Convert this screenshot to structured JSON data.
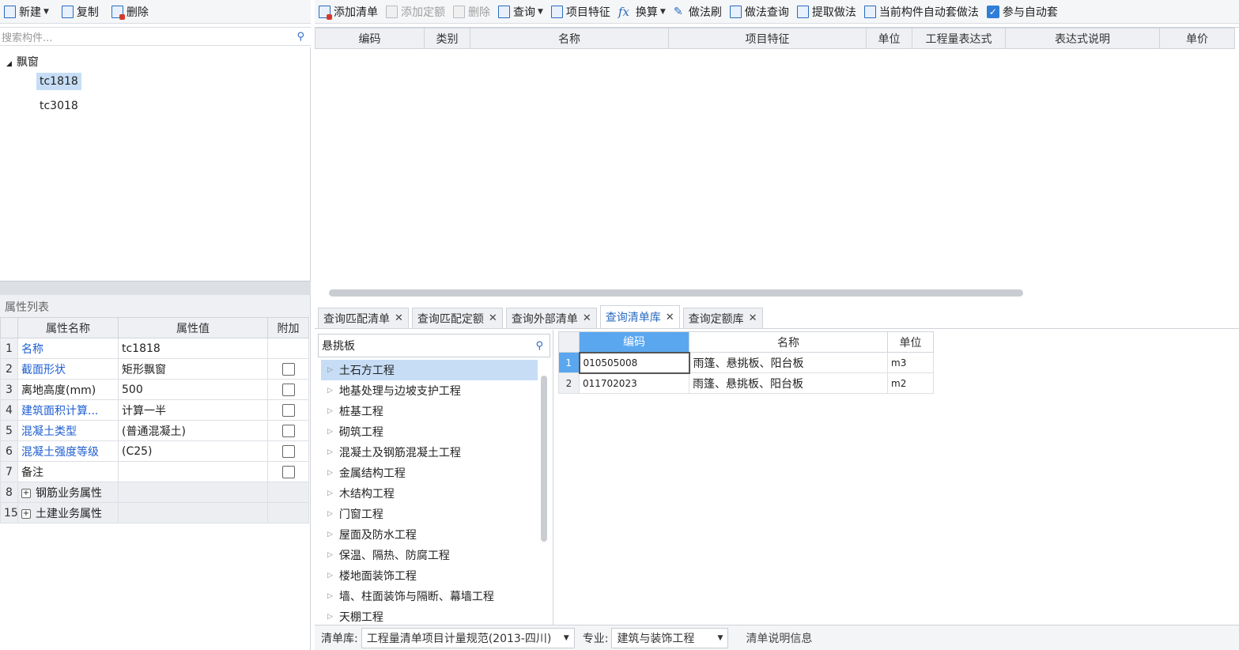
{
  "left_toolbar": {
    "new": "新建",
    "copy": "复制",
    "delete": "删除"
  },
  "left_search": {
    "placeholder": "搜索构件..."
  },
  "tree": {
    "root": "飘窗",
    "items": [
      "tc1818",
      "tc3018"
    ]
  },
  "props": {
    "title": "属性列表",
    "headers": [
      "属性名称",
      "属性值",
      "附加"
    ],
    "rows": [
      {
        "num": "1",
        "name": "名称",
        "value": "tc1818",
        "blue": true,
        "check": false
      },
      {
        "num": "2",
        "name": "截面形状",
        "value": "矩形飘窗",
        "blue": true,
        "check": true
      },
      {
        "num": "3",
        "name": "离地高度(mm)",
        "value": "500",
        "blue": false,
        "check": true
      },
      {
        "num": "4",
        "name": "建筑面积计算...",
        "value": "计算一半",
        "blue": true,
        "check": true
      },
      {
        "num": "5",
        "name": "混凝土类型",
        "value": "(普通混凝土)",
        "blue": true,
        "check": true
      },
      {
        "num": "6",
        "name": "混凝土强度等级",
        "value": "(C25)",
        "blue": true,
        "check": true
      },
      {
        "num": "7",
        "name": "备注",
        "value": "",
        "blue": false,
        "check": true
      },
      {
        "num": "8",
        "name": "钢筋业务属性",
        "value": "",
        "group": true
      },
      {
        "num": "15",
        "name": "土建业务属性",
        "value": "",
        "group": true
      }
    ]
  },
  "main_toolbar": {
    "add_list": "添加清单",
    "add_quota": "添加定额",
    "delete": "删除",
    "query": "查询",
    "item_feature": "项目特征",
    "convert": "换算",
    "method_brush": "做法刷",
    "method_query": "做法查询",
    "extract_method": "提取做法",
    "auto_method": "当前构件自动套做法",
    "auto_join": "参与自动套"
  },
  "upper_grid": {
    "headers": [
      "编码",
      "类别",
      "名称",
      "项目特征",
      "单位",
      "工程量表达式",
      "表达式说明",
      "单价"
    ]
  },
  "tabs": [
    "查询匹配清单",
    "查询匹配定额",
    "查询外部清单",
    "查询清单库",
    "查询定额库"
  ],
  "lib_search": {
    "value": "悬挑板"
  },
  "lib_tree": [
    "土石方工程",
    "地基处理与边坡支护工程",
    "桩基工程",
    "砌筑工程",
    "混凝土及钢筋混凝土工程",
    "金属结构工程",
    "木结构工程",
    "门窗工程",
    "屋面及防水工程",
    "保温、隔热、防腐工程",
    "楼地面装饰工程",
    "墙、柱面装饰与隔断、幕墙工程",
    "天棚工程"
  ],
  "result_grid": {
    "headers": [
      "编码",
      "名称",
      "单位"
    ],
    "rows": [
      {
        "num": "1",
        "code": "010505008",
        "name": "雨篷、悬挑板、阳台板",
        "unit": "m3"
      },
      {
        "num": "2",
        "code": "011702023",
        "name": "雨篷、悬挑板、阳台板",
        "unit": "m2"
      }
    ]
  },
  "status": {
    "lib_label": "清单库:",
    "lib_value": "工程量清单项目计量规范(2013-四川)",
    "spec_label": "专业:",
    "spec_value": "建筑与装饰工程",
    "info": "清单说明信息"
  }
}
